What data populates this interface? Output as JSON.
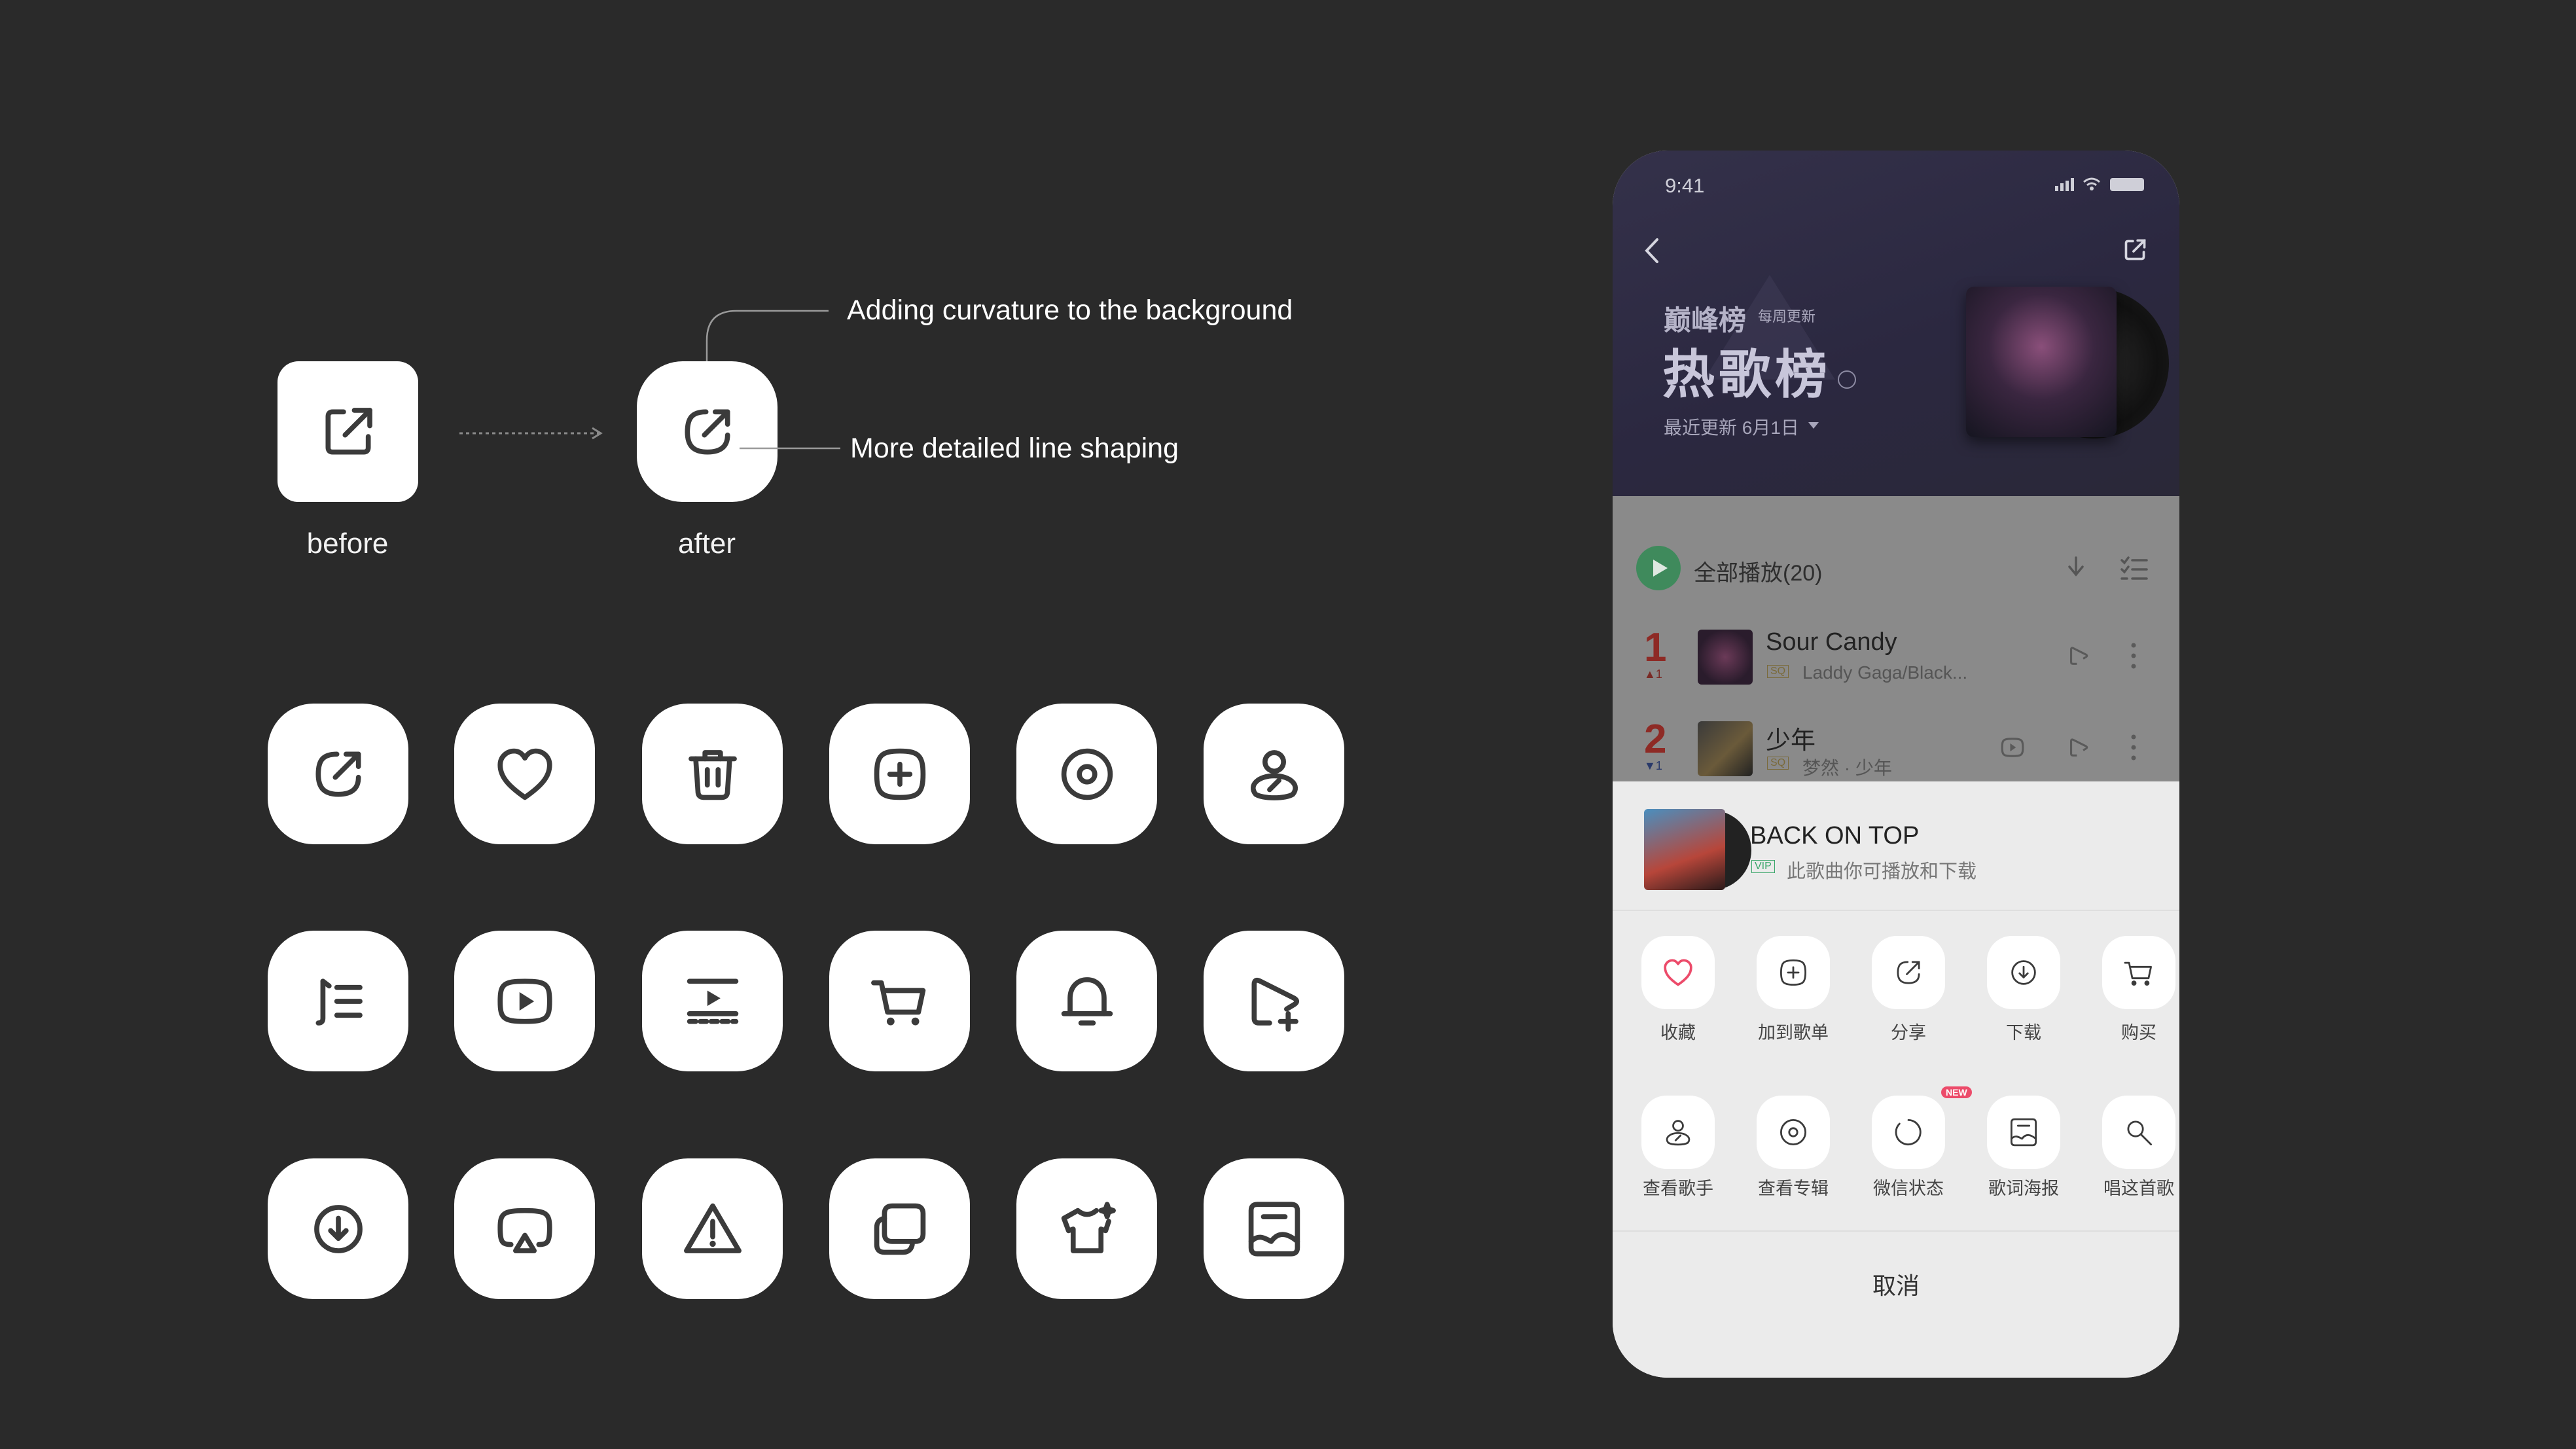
{
  "comparison": {
    "before_label": "before",
    "after_label": "after",
    "annotation_curvature": "Adding curvature to the background",
    "annotation_line": "More detailed line shaping"
  },
  "icon_grid": [
    "share-icon",
    "heart-icon",
    "trash-icon",
    "add-square-icon",
    "disc-icon",
    "artist-icon",
    "playlist-icon",
    "video-play-icon",
    "mv-icon",
    "cart-icon",
    "bell-icon",
    "add-to-playlist-icon",
    "download-icon",
    "airplay-icon",
    "warning-icon",
    "copy-icon",
    "tshirt-icon",
    "poster-icon"
  ],
  "phone": {
    "status_time": "9:41",
    "chart_brand": "巅峰榜",
    "update_freq": "每周更新",
    "chart_title": "热歌榜",
    "last_update": "最近更新 6月1日",
    "play_all": "全部播放(20)",
    "songs": [
      {
        "rank": "1",
        "title": "Sour Candy",
        "quality": "SQ",
        "artist": "Laddy Gaga/Black...",
        "trend": "▲1"
      },
      {
        "rank": "2",
        "title": "少年",
        "quality": "SQ",
        "artist": "梦然 · 少年",
        "trend": "▼1"
      }
    ],
    "sheet": {
      "song_title": "BACK ON TOP",
      "vip_badge": "VIP",
      "song_note": "此歌曲你可播放和下载",
      "actions_row1": [
        {
          "label": "收藏",
          "icon": "heart-icon"
        },
        {
          "label": "加到歌单",
          "icon": "add-square-icon"
        },
        {
          "label": "分享",
          "icon": "share-icon"
        },
        {
          "label": "下载",
          "icon": "download-icon"
        },
        {
          "label": "购买",
          "icon": "cart-icon"
        }
      ],
      "actions_row2": [
        {
          "label": "查看歌手",
          "icon": "artist-icon"
        },
        {
          "label": "查看专辑",
          "icon": "disc-icon"
        },
        {
          "label": "微信状态",
          "icon": "status-ring-icon",
          "badge": "NEW"
        },
        {
          "label": "歌词海报",
          "icon": "poster-icon"
        },
        {
          "label": "唱这首歌",
          "icon": "mic-icon"
        }
      ],
      "cancel": "取消"
    }
  },
  "colors": {
    "background": "#2a2a2a",
    "tile": "#ffffff",
    "rank_red": "#e0443c",
    "play_green": "#3aa66a",
    "heart_pink": "#ec4b6a"
  }
}
